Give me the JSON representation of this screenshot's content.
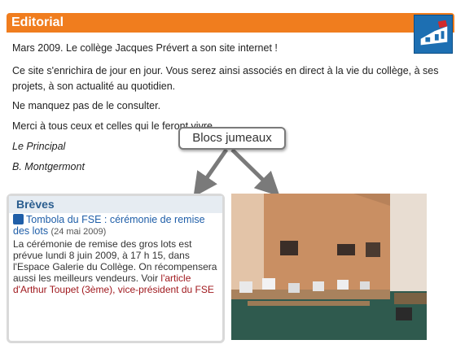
{
  "editorial": {
    "title": "Editorial",
    "p1": "Mars 2009. Le collège Jacques Prévert a son site internet !",
    "p2_line1": "Ce site s'enrichira de jour en jour. Vous serez ainsi associés en direct à la vie du collège, à ses",
    "p2_line2": "projets, à son actualité au quotidien.",
    "p3": "Ne manquez pas de le consulter.",
    "p4": "Merci à tous ceux et celles qui le feront vivre.",
    "signature_role": "Le Principal",
    "signature_name": "B. Montgermont"
  },
  "callout": {
    "label": "Blocs jumeaux"
  },
  "breves": {
    "title": "Brèves",
    "entry": {
      "link_text": "Tombola du FSE : cérémonie de remise des lots",
      "date": "(24 mai 2009)",
      "body": "La cérémonie de remise des gros lots est prévue lundi 8 juin 2009, à 17 h 15, dans l'Espace Galerie du Collège. On récompensera aussi les meilleurs vendeurs. Voir ",
      "article_link": "l'article d'Arthur Toupet (3ème), vice-président du FSE"
    }
  },
  "colors": {
    "header_orange": "#f07d1e",
    "link_blue": "#1f5ea8",
    "link_red": "#a0191e",
    "logo_blue": "#1d6fb2"
  }
}
